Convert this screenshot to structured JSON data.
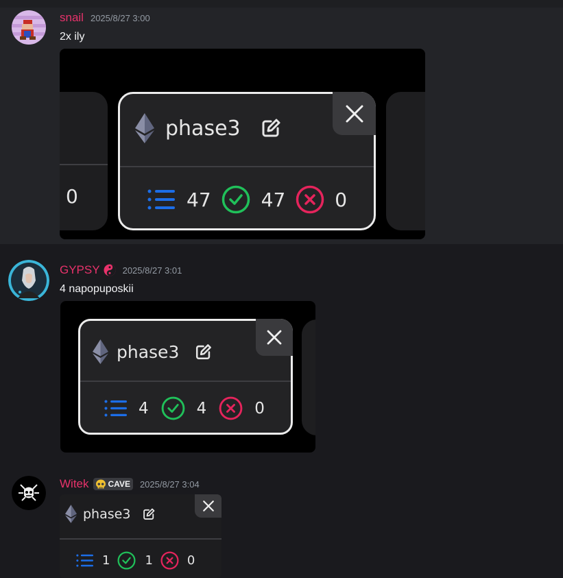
{
  "messages": [
    {
      "username": "snail",
      "timestamp": "2025/8/27 3:00",
      "text": "2x ily",
      "card": {
        "title": "phase3",
        "total": "47",
        "success": "47",
        "failed": "0",
        "partial_left_value": "0"
      }
    },
    {
      "username": "GYPSY",
      "timestamp": "2025/8/27 3:01",
      "text": "4 napopuposkii",
      "card": {
        "title": "phase3",
        "total": "4",
        "success": "4",
        "failed": "0"
      }
    },
    {
      "username": "Witek",
      "badge": "CAVE",
      "timestamp": "2025/8/27 3:04",
      "card": {
        "title": "phase3",
        "total": "1",
        "success": "1",
        "failed": "0"
      }
    }
  ],
  "colors": {
    "username": "#e8326b",
    "timestamp": "#949ba4",
    "list_icon": "#1c6ee8",
    "success_icon": "#20c05a",
    "failed_icon": "#e5245c"
  },
  "icons": [
    "ethereum-icon",
    "edit-icon",
    "close-icon",
    "list-icon",
    "check-circle-icon",
    "x-circle-icon",
    "yin-yang-icon",
    "skull-icon"
  ]
}
